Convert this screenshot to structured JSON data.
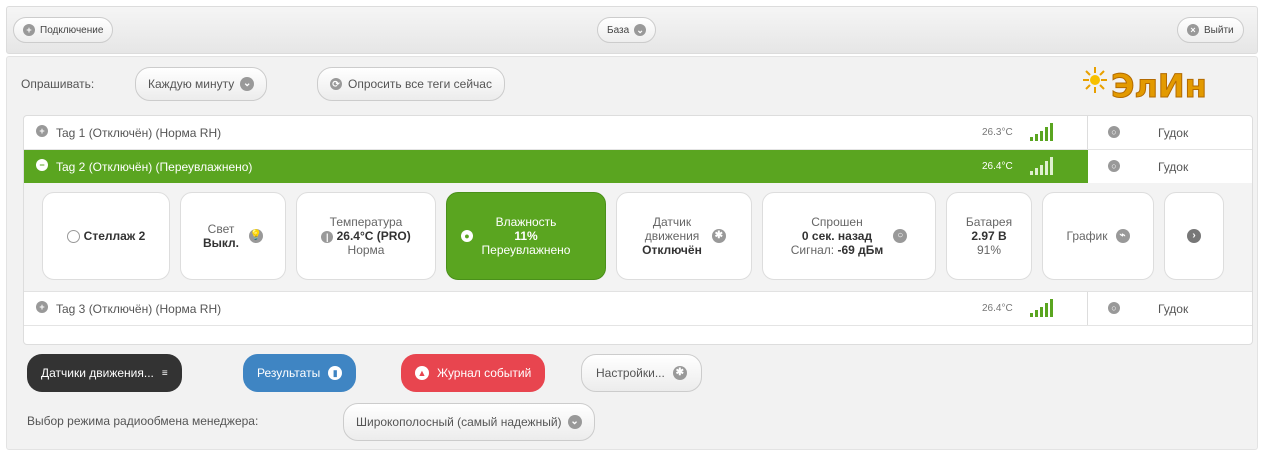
{
  "topbar": {
    "connection_label": "Подключение",
    "base_label": "База",
    "logout_label": "Выйти"
  },
  "poll": {
    "label": "Опрашивать:",
    "interval_value": "Каждую минуту",
    "poll_all_label": "Опросить все теги сейчас"
  },
  "logo": {
    "text": "ЭлИн"
  },
  "tags": [
    {
      "name": "Tag 1 (Отключён) (Норма RH)",
      "temp": "26.3°C",
      "beep_label": "Гудок"
    },
    {
      "name": "Tag 2 (Отключён) (Переувлажнено)",
      "temp": "26.4°C",
      "beep_label": "Гудок"
    },
    {
      "name": "Tag 3 (Отключён) (Норма RH)",
      "temp": "26.4°C",
      "beep_label": "Гудок"
    }
  ],
  "details": {
    "shelf": "Стеллаж 2",
    "light_label": "Свет",
    "light_value": "Выкл.",
    "temperature_label": "Температура",
    "temperature_value": "26.4°C (PRO)",
    "temperature_status": "Норма",
    "humidity_label": "Влажность",
    "humidity_value": "11%",
    "humidity_status": "Переувлажнено",
    "motion_label_1": "Датчик",
    "motion_label_2": "движения",
    "motion_value": "Отключён",
    "polled_label": "Спрошен",
    "polled_value": "0 сек. назад",
    "signal_label": "Сигнал:",
    "signal_value": "-69 дБм",
    "battery_label": "Батарея",
    "battery_value": "2.97 В",
    "battery_percent": "91%",
    "graph_label": "График"
  },
  "actions": {
    "motion_sensors": "Датчики движения...",
    "results": "Результаты",
    "event_log": "Журнал событий",
    "settings": "Настройки..."
  },
  "radio": {
    "label": "Выбор режима радиообмена менеджера:",
    "value": "Широкополосный (самый надежный)"
  },
  "colors": {
    "active_green": "#5aa520",
    "dark_button": "#333333",
    "blue_button": "#3f85c3",
    "red_button": "#e8454f"
  },
  "icons": {
    "expand": "plus-circle-icon",
    "collapse": "minus-circle-icon",
    "dropdown": "chevron-down-icon",
    "signal": "signal-bars-icon",
    "search": "search-icon",
    "humidity": "drop-icon",
    "next": "chevron-right-icon"
  }
}
